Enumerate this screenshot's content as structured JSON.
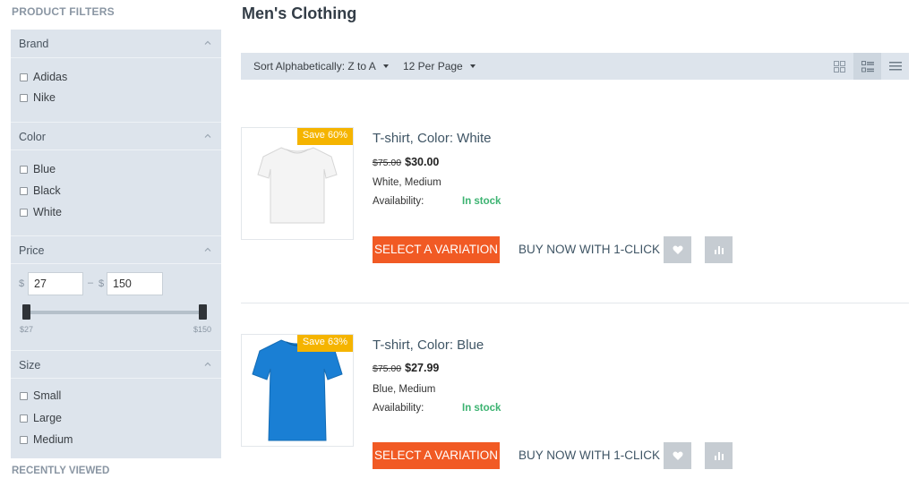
{
  "sidebar": {
    "title": "PRODUCT FILTERS",
    "brand": {
      "label": "Brand",
      "options": [
        "Adidas",
        "Nike"
      ]
    },
    "color": {
      "label": "Color",
      "options": [
        "Blue",
        "Black",
        "White"
      ]
    },
    "price": {
      "label": "Price",
      "currency": "$",
      "dash": "–",
      "min_value": "27",
      "max_value": "150",
      "min_label": "$27",
      "max_label": "$150"
    },
    "size": {
      "label": "Size",
      "options": [
        "Small",
        "Large",
        "Medium"
      ]
    },
    "recently_viewed": "RECENTLY VIEWED"
  },
  "main": {
    "title": "Men's Clothing",
    "toolbar": {
      "sort_label": "Sort Alphabetically: Z to A",
      "per_page_label": "12 Per Page",
      "views": [
        "grid-view",
        "list-grid-view",
        "list-view"
      ],
      "active_view": "list-grid-view"
    },
    "products": [
      {
        "title": "T-shirt, Color: White",
        "badge": "Save 60%",
        "old_price": "$75.00",
        "new_price": "$30.00",
        "attributes": "White, Medium",
        "availability_label": "Availability:",
        "stock": "In stock",
        "select_label": "SELECT A VARIATION",
        "buy_label": "BUY NOW WITH 1-CLICK",
        "shirt_color": "#f4f4f4"
      },
      {
        "title": "T-shirt, Color: Blue",
        "badge": "Save 63%",
        "old_price": "$75.00",
        "new_price": "$27.99",
        "attributes": "Blue, Medium",
        "availability_label": "Availability:",
        "stock": "In stock",
        "select_label": "SELECT A VARIATION",
        "buy_label": "BUY NOW WITH 1-CLICK",
        "shirt_color": "#1a7fd4"
      }
    ]
  },
  "colors": {
    "accent": "#f15a24",
    "badge": "#f5b400",
    "in_stock": "#3cb371",
    "panel": "#dde4ec"
  }
}
